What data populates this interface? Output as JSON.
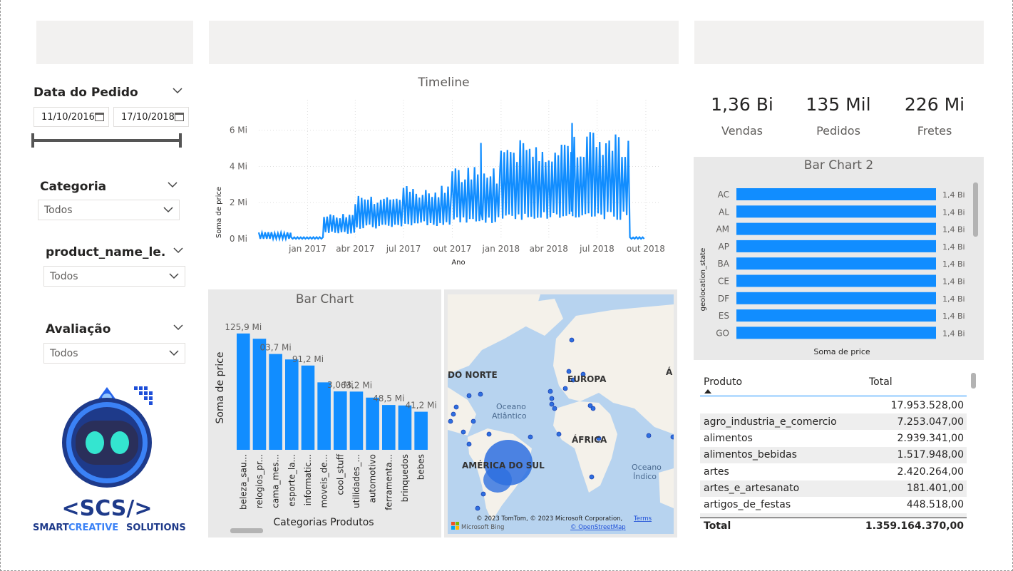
{
  "colors": {
    "accent": "#118dff",
    "panel_bg": "#e9e9e9",
    "placeholder": "#f2f1f0"
  },
  "slicers": {
    "date": {
      "title": "Data do Pedido",
      "start": "11/10/2016",
      "end": "17/10/2018"
    },
    "category": {
      "title": "Categoria",
      "value": "Todos"
    },
    "product": {
      "title": "product_name_le...",
      "value": "Todos"
    },
    "rating": {
      "title": "Avaliação",
      "value": "Todos"
    }
  },
  "logo": {
    "text": "<SCS/>",
    "subtitle_1": "SMART",
    "subtitle_2": "CREATIVE",
    "subtitle_3": "SOLUTIONS"
  },
  "timeline": {
    "title": "Timeline",
    "xlabel": "Ano",
    "ylabel": "Soma de price",
    "yticks": [
      "0 Mi",
      "2 Mi",
      "4 Mi",
      "6 Mi"
    ],
    "xticks": [
      "jan 2017",
      "abr 2017",
      "jul 2017",
      "out 2017",
      "jan 2018",
      "abr 2018",
      "jul 2018",
      "out 2018"
    ]
  },
  "kpis": [
    {
      "value": "1,36 Bi",
      "label": "Vendas"
    },
    {
      "value": "135 Mil",
      "label": "Pedidos"
    },
    {
      "value": "226 Mi",
      "label": "Fretes"
    }
  ],
  "bar_chart": {
    "title": "Bar Chart",
    "xlabel": "Categorias Produtos",
    "ylabel": "Soma de price",
    "categories": [
      "beleza_sau...",
      "relogios_pr...",
      "cama_mes...",
      "esporte_la...",
      "informatic...",
      "moveis_de...",
      "cool_stuff",
      "utilidades_...",
      "automotivo",
      "ferramenta...",
      "brinquedos",
      "bebes"
    ],
    "value_labels": [
      "125,9 Mi",
      "03,7 Mi",
      "91,2 Mi",
      "3,0 Mi",
      "63,2 Mi",
      "48,5 Mi",
      "41,2 Mi"
    ]
  },
  "bar_chart_2": {
    "title": "Bar Chart 2",
    "xlabel": "Soma de price",
    "ylabel": "geolocation_state",
    "categories": [
      "AC",
      "AL",
      "AM",
      "AP",
      "BA",
      "CE",
      "DF",
      "ES",
      "GO"
    ],
    "value_label": "1,4 Bi"
  },
  "map": {
    "labels": [
      "DO NORTE",
      "EUROPA",
      "Oceano",
      "Atlântico",
      "ÁFRICA",
      "AMÉRICA DO SUL",
      "Oceano",
      "Índico",
      "Á"
    ],
    "attribution": "© 2023 TomTom, © 2023 Microsoft Corporation,",
    "terms": "Terms",
    "osm": "© OpenStreetMap",
    "brand": "Microsoft Bing"
  },
  "table": {
    "headers": [
      "Produto",
      "Total"
    ],
    "rows": [
      [
        "",
        "17.953.528,00"
      ],
      [
        "agro_industria_e_comercio",
        "7.253.047,00"
      ],
      [
        "alimentos",
        "2.939.341,00"
      ],
      [
        "alimentos_bebidas",
        "1.517.948,00"
      ],
      [
        "artes",
        "2.420.264,00"
      ],
      [
        "artes_e_artesanato",
        "181.401,00"
      ],
      [
        "artigos_de_festas",
        "448.518,00"
      ]
    ],
    "total_label": "Total",
    "total_value": "1.359.164.370,00"
  },
  "chart_data": [
    {
      "type": "bar",
      "title": "Bar Chart",
      "xlabel": "Categorias Produtos",
      "ylabel": "Soma de price",
      "categories": [
        "beleza_sau...",
        "relogios_pr...",
        "cama_mes...",
        "esporte_la...",
        "informatic...",
        "moveis_de...",
        "cool_stuff",
        "utilidades_...",
        "automotivo",
        "ferramenta...",
        "brinquedos",
        "bebes"
      ],
      "values": [
        125.9,
        120.2,
        103.7,
        97.8,
        91.2,
        73.0,
        63.2,
        63.0,
        56.5,
        48.5,
        48.0,
        41.2
      ],
      "ylim": [
        0,
        135
      ]
    },
    {
      "type": "bar",
      "orientation": "horizontal",
      "title": "Bar Chart 2",
      "xlabel": "Soma de price",
      "ylabel": "geolocation_state",
      "categories": [
        "AC",
        "AL",
        "AM",
        "AP",
        "BA",
        "CE",
        "DF",
        "ES",
        "GO"
      ],
      "values": [
        1.36,
        1.36,
        1.36,
        1.36,
        1.36,
        1.36,
        1.36,
        1.36,
        1.36
      ]
    },
    {
      "type": "line",
      "title": "Timeline",
      "xlabel": "Ano",
      "ylabel": "Soma de price",
      "ylim": [
        0,
        6.5
      ],
      "x_range": [
        "2016-10",
        "2018-10"
      ],
      "phases": [
        {
          "from": "2016-10",
          "to": "2016-12",
          "low": 0.0,
          "high": 0.4
        },
        {
          "from": "2016-12",
          "to": "2017-02",
          "low": 0.0,
          "high": 0.1
        },
        {
          "from": "2017-02",
          "to": "2017-04",
          "low": 0.4,
          "high": 1.5
        },
        {
          "from": "2017-04",
          "to": "2017-07",
          "low": 0.8,
          "high": 2.5
        },
        {
          "from": "2017-07",
          "to": "2017-10",
          "low": 1.0,
          "high": 3.0
        },
        {
          "from": "2017-10",
          "to": "2018-01",
          "low": 1.2,
          "high": 4.0
        },
        {
          "from": "2018-01",
          "to": "2018-05",
          "low": 1.5,
          "high": 5.5
        },
        {
          "from": "2018-05",
          "to": "2018-09",
          "low": 1.5,
          "high": 6.0
        },
        {
          "from": "2018-09",
          "to": "2018-10",
          "low": 0.0,
          "high": 0.1
        }
      ],
      "peaks": [
        {
          "x": "2017-11-24",
          "y": 5.3
        },
        {
          "x": "2018-05-15",
          "y": 6.4
        }
      ]
    }
  ]
}
